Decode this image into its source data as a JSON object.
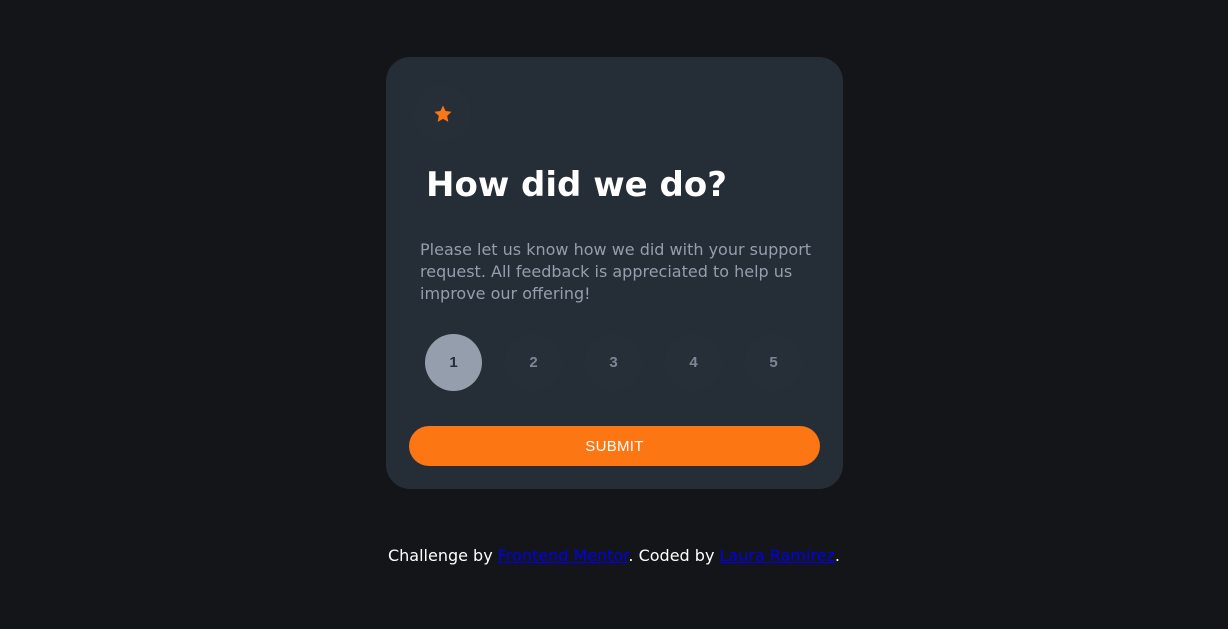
{
  "card": {
    "icon": "star-icon",
    "title": "How did we do?",
    "description": "Please let us know how we did with your support request. All feedback is appreciated to help us improve our offering!",
    "ratings": [
      {
        "label": "1",
        "selected": true
      },
      {
        "label": "2",
        "selected": false
      },
      {
        "label": "3",
        "selected": false
      },
      {
        "label": "4",
        "selected": false
      },
      {
        "label": "5",
        "selected": false
      }
    ],
    "submit_label": "SUBMIT"
  },
  "attribution": {
    "prefix": "Challenge by ",
    "link1": "Frontend Mentor",
    "middle": ". Coded by ",
    "link2": "Laura Ramírez",
    "suffix": "."
  },
  "colors": {
    "background": "#131518",
    "card": "#252d37",
    "accent": "#fc7614",
    "selected_rating": "#959eac",
    "muted_text": "#959eac"
  }
}
